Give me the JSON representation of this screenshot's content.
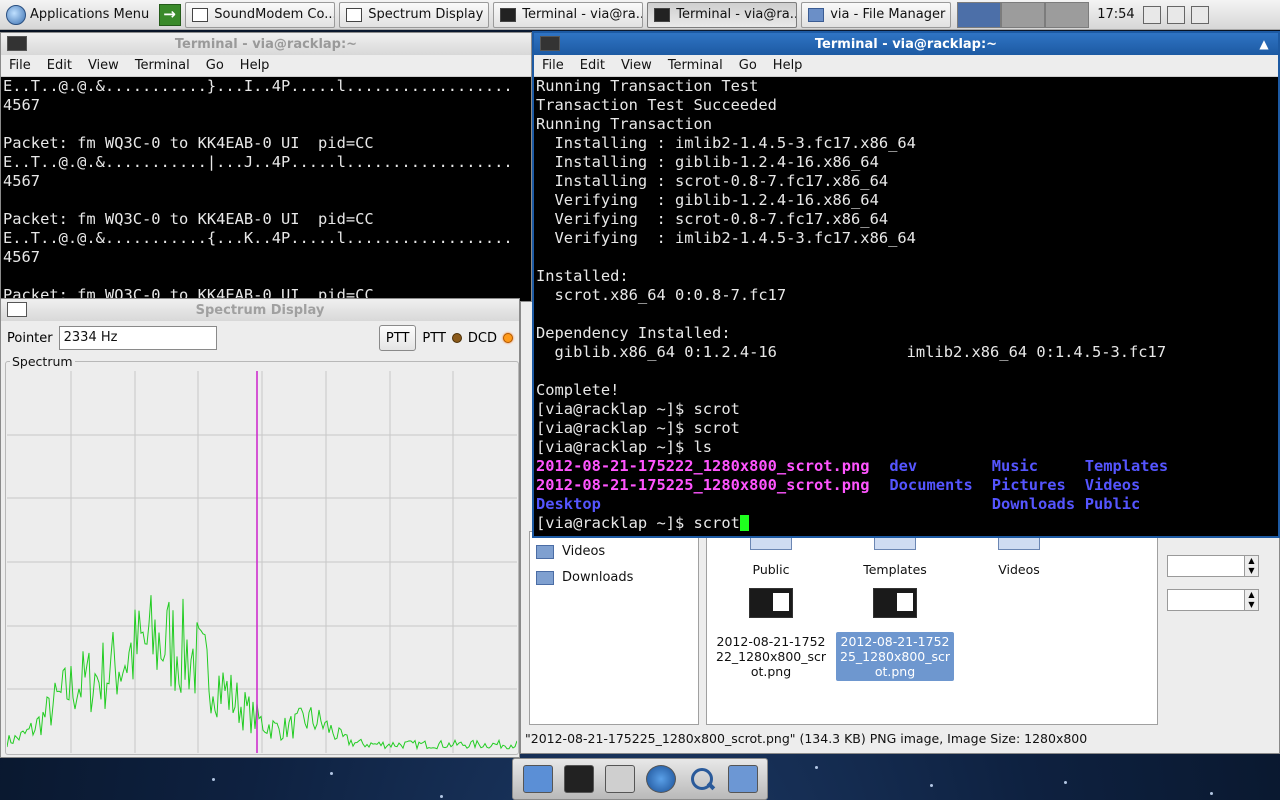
{
  "top_panel": {
    "apps_menu_label": "Applications Menu",
    "tasks": [
      {
        "label": "SoundModem Co...",
        "icon": "window-icon"
      },
      {
        "label": "Spectrum Display",
        "icon": "window-icon"
      },
      {
        "label": "Terminal - via@ra...",
        "icon": "terminal-icon"
      },
      {
        "label": "Terminal - via@ra...",
        "icon": "terminal-icon"
      },
      {
        "label": "via - File Manager",
        "icon": "folder-icon"
      }
    ],
    "clock": "17:54"
  },
  "terminal_left": {
    "title": "Terminal - via@racklap:~",
    "menu": [
      "File",
      "Edit",
      "View",
      "Terminal",
      "Go",
      "Help"
    ],
    "lines": [
      "E..T..@.@.&...........}...I..4P.....l..................",
      "4567",
      "",
      "Packet: fm WQ3C-0 to KK4EAB-0 UI  pid=CC",
      "E..T..@.@.&...........|...J..4P.....l..................",
      "4567",
      "",
      "Packet: fm WQ3C-0 to KK4EAB-0 UI  pid=CC",
      "E..T..@.@.&...........{...K..4P.....l..................",
      "4567",
      "",
      "Packet: fm WQ3C-0 to KK4EAB-0 UI  pid=CC"
    ]
  },
  "terminal_right": {
    "title": "Terminal - via@racklap:~",
    "menu": [
      "File",
      "Edit",
      "View",
      "Terminal",
      "Go",
      "Help"
    ],
    "lines": [
      "Running Transaction Test",
      "Transaction Test Succeeded",
      "Running Transaction",
      "  Installing : imlib2-1.4.5-3.fc17.x86_64",
      "  Installing : giblib-1.2.4-16.x86_64",
      "  Installing : scrot-0.8-7.fc17.x86_64",
      "  Verifying  : giblib-1.2.4-16.x86_64",
      "  Verifying  : scrot-0.8-7.fc17.x86_64",
      "  Verifying  : imlib2-1.4.5-3.fc17.x86_64",
      "",
      "Installed:",
      "  scrot.x86_64 0:0.8-7.fc17",
      "",
      "Dependency Installed:",
      "  giblib.x86_64 0:1.2.4-16              imlib2.x86_64 0:1.4.5-3.fc17",
      "",
      "Complete!",
      "[via@racklap ~]$ scrot",
      "[via@racklap ~]$ scrot",
      "[via@racklap ~]$ ls"
    ],
    "ls_rows": [
      [
        {
          "text": "2012-08-21-175222_1280x800_scrot.png",
          "kind": "image"
        },
        {
          "text": "dev",
          "kind": "dir"
        },
        {
          "text": "Music",
          "kind": "dir"
        },
        {
          "text": "Templates",
          "kind": "dir"
        }
      ],
      [
        {
          "text": "2012-08-21-175225_1280x800_scrot.png",
          "kind": "image"
        },
        {
          "text": "Documents",
          "kind": "dir"
        },
        {
          "text": "Pictures",
          "kind": "dir"
        },
        {
          "text": "Videos",
          "kind": "dir"
        }
      ],
      [
        {
          "text": "Desktop",
          "kind": "dir"
        },
        {
          "text": "",
          "kind": "dir"
        },
        {
          "text": "Downloads",
          "kind": "dir"
        },
        {
          "text": "Public",
          "kind": "dir"
        }
      ]
    ],
    "prompt_final": "[via@racklap ~]$ scrot",
    "colors": {
      "image": "#ff55ff",
      "dir": "#5555ff",
      "text": "#e8e8e8",
      "cursor": "#1eff1e"
    }
  },
  "spectrum": {
    "title": "Spectrum Display",
    "pointer_label": "Pointer",
    "pointer_value": "2334 Hz",
    "ptt_button_label": "PTT",
    "ptt_indicator_label": "PTT",
    "dcd_label": "DCD",
    "group_label": "Spectrum",
    "trace_color": "#22cc22",
    "marker_color": "#cc22cc"
  },
  "file_manager": {
    "sidebar_items": [
      "Videos",
      "Downloads"
    ],
    "tiles": [
      {
        "label": "Public",
        "kind": "folder",
        "selected": false
      },
      {
        "label": "Templates",
        "kind": "folder",
        "selected": false
      },
      {
        "label": "Videos",
        "kind": "folder",
        "selected": false
      },
      {
        "label": "2012-08-21-175222_1280x800_scrot.png",
        "kind": "image",
        "selected": false
      },
      {
        "label": "2012-08-21-175225_1280x800_scrot.png",
        "kind": "image",
        "selected": true
      }
    ],
    "status": "\"2012-08-21-175225_1280x800_scrot.png\" (134.3 KB) PNG image, Image Size: 1280x800"
  }
}
